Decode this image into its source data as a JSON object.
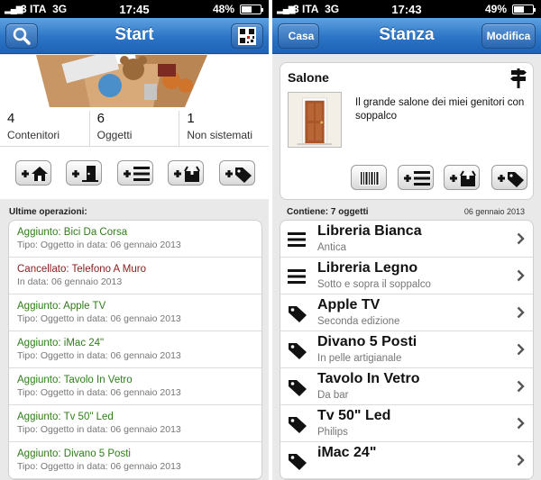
{
  "left": {
    "status": {
      "carrier": "3 ITA",
      "network": "3G",
      "time": "17:45",
      "battery": "48%",
      "battery_level": 0.48
    },
    "nav": {
      "title": "Start"
    },
    "stats": [
      {
        "value": "4",
        "label": "Contenitori"
      },
      {
        "value": "6",
        "label": "Oggetti"
      },
      {
        "value": "1",
        "label": "Non sistemati"
      }
    ],
    "section_label": "Ultime operazioni:",
    "operations": [
      {
        "title": "Aggiunto: Bici Da Corsa",
        "sub": "Tipo: Oggetto in data: 06 gennaio 2013",
        "kind": "added"
      },
      {
        "title": "Cancellato: Telefono A Muro",
        "sub": "In data: 06 gennaio 2013",
        "kind": "removed"
      },
      {
        "title": "Aggiunto: Apple TV",
        "sub": "Tipo: Oggetto in data: 06 gennaio 2013",
        "kind": "added"
      },
      {
        "title": "Aggiunto: iMac 24\"",
        "sub": "Tipo: Oggetto in data: 06 gennaio 2013",
        "kind": "added"
      },
      {
        "title": "Aggiunto: Tavolo In Vetro",
        "sub": "Tipo: Oggetto in data: 06 gennaio 2013",
        "kind": "added"
      },
      {
        "title": "Aggiunto: Tv 50\" Led",
        "sub": "Tipo: Oggetto in data: 06 gennaio 2013",
        "kind": "added"
      },
      {
        "title": "Aggiunto: Divano 5 Posti",
        "sub": "Tipo: Oggetto in data: 06 gennaio 2013",
        "kind": "added"
      }
    ]
  },
  "right": {
    "status": {
      "carrier": "3 ITA",
      "network": "3G",
      "time": "17:43",
      "battery": "49%",
      "battery_level": 0.49
    },
    "nav": {
      "title": "Stanza",
      "back_label": "Casa",
      "edit_label": "Modifica"
    },
    "room": {
      "name": "Salone",
      "description": "Il grande salone dei miei genitori con soppalco"
    },
    "contents_label": "Contiene: 7 oggetti",
    "contents_date": "06 gennaio 2013",
    "items": [
      {
        "title": "Libreria Bianca",
        "sub": "Antica",
        "icon": "shelf-icon"
      },
      {
        "title": "Libreria Legno",
        "sub": "Sotto e sopra il soppalco",
        "icon": "shelf-icon"
      },
      {
        "title": "Apple TV",
        "sub": "Seconda edizione",
        "icon": "tag-icon"
      },
      {
        "title": "Divano 5 Posti",
        "sub": "In pelle artigianale",
        "icon": "tag-icon"
      },
      {
        "title": "Tavolo In Vetro",
        "sub": "Da bar",
        "icon": "tag-icon"
      },
      {
        "title": "Tv 50\" Led",
        "sub": "Philips",
        "icon": "tag-icon"
      },
      {
        "title": "iMac 24\"",
        "sub": "",
        "icon": "tag-icon"
      }
    ]
  },
  "colors": {
    "nav_blue": "#2b74c6",
    "added": "#2e7d18",
    "removed": "#8b1a1a"
  }
}
